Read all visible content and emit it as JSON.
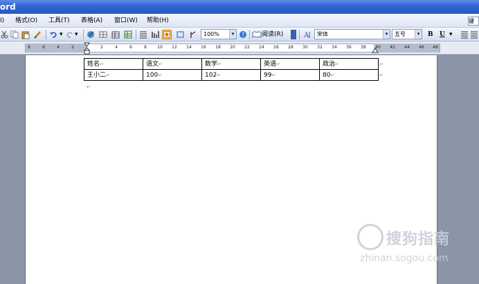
{
  "window": {
    "title": "ord"
  },
  "menu": {
    "items": [
      "I)",
      "格式(O)",
      "工具(T)",
      "表格(A)",
      "窗口(W)",
      "帮助(H)"
    ],
    "help_box": "键入"
  },
  "toolbar": {
    "zoom": "100%",
    "read_label": "阅读(R)",
    "font_name": "宋体",
    "font_size": "五号",
    "bold": "B",
    "underline": "U"
  },
  "ruler": {
    "left_ticks": [
      "8",
      "6",
      "4",
      "2"
    ],
    "ticks": [
      "2",
      "4",
      "6",
      "8",
      "10",
      "12",
      "14",
      "16",
      "18",
      "20",
      "22",
      "24",
      "26",
      "28",
      "30",
      "32",
      "34",
      "36",
      "38",
      "40",
      "42",
      "44",
      "46",
      "48"
    ]
  },
  "document": {
    "table": {
      "header": [
        "姓名",
        "语文",
        "数学",
        "英语",
        "政治"
      ],
      "rows": [
        [
          "王小二",
          "100",
          "102",
          "99",
          "80"
        ]
      ]
    },
    "cell_mark": "↵",
    "para_mark": "↵"
  },
  "watermark": {
    "brand": "搜狗指南",
    "url": "zhinan.sogou.com"
  },
  "colors": {
    "titlebar": "#2f63d0",
    "workarea": "#8c94a8",
    "active_button": "#f5c66a"
  }
}
